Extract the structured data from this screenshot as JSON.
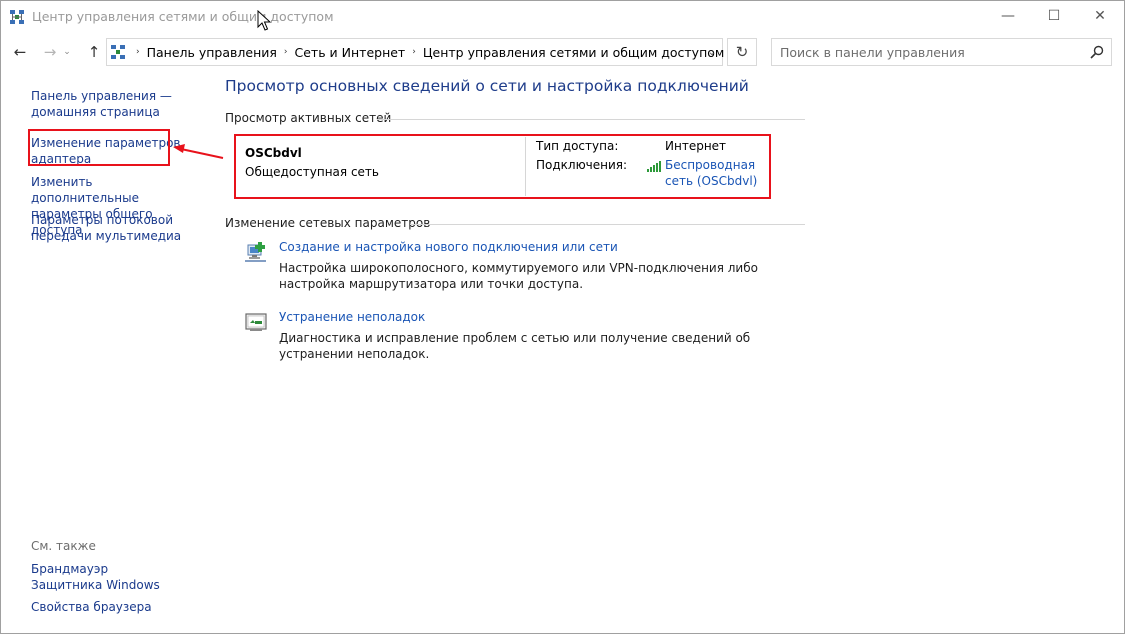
{
  "window": {
    "title": "Центр управления сетями и общим доступом",
    "controls": {
      "minimize": "—",
      "maximize": "☐",
      "close": "✕"
    }
  },
  "nav": {
    "back": "←",
    "forward": "→",
    "recent": "⌄",
    "up": "↑",
    "breadcrumbs": [
      "Панель управления",
      "Сеть и Интернет",
      "Центр управления сетями и общим доступом"
    ],
    "separator": "›",
    "dropdown": "⌄",
    "refresh": "↻",
    "search_placeholder": "Поиск в панели управления"
  },
  "sidebar": {
    "links": [
      "Панель управления — домашняя страница",
      "Изменение параметров адаптера",
      "Изменить дополнительные параметры общего доступа",
      "Параметры потоковой передачи мультимедиа"
    ],
    "see_also_label": "См. также",
    "see_also_links": [
      "Брандмауэр Защитника Windows",
      "Свойства браузера"
    ]
  },
  "main": {
    "title": "Просмотр основных сведений о сети и настройка подключений",
    "active_networks_header": "Просмотр активных сетей",
    "network": {
      "name": "OSCbdvl",
      "type": "Общедоступная сеть",
      "access_type_label": "Тип доступа:",
      "access_type_value": "Интернет",
      "connections_label": "Подключения:",
      "connection_link": "Беспроводная сеть (OSCbdvl)"
    },
    "change_settings_header": "Изменение сетевых параметров",
    "tasks": [
      {
        "icon": "new-connection-icon",
        "link": "Создание и настройка нового подключения или сети",
        "description": "Настройка широкополосного, коммутируемого или VPN-подключения либо настройка маршрутизатора или точки доступа."
      },
      {
        "icon": "troubleshoot-icon",
        "link": "Устранение неполадок",
        "description": "Диагностика и исправление проблем с сетью или получение сведений об устранении неполадок."
      }
    ]
  },
  "colors": {
    "link": "#1a55b5",
    "nav_link": "#1a3a8c",
    "title": "#1e3c8a",
    "highlight": "#e8121b"
  }
}
